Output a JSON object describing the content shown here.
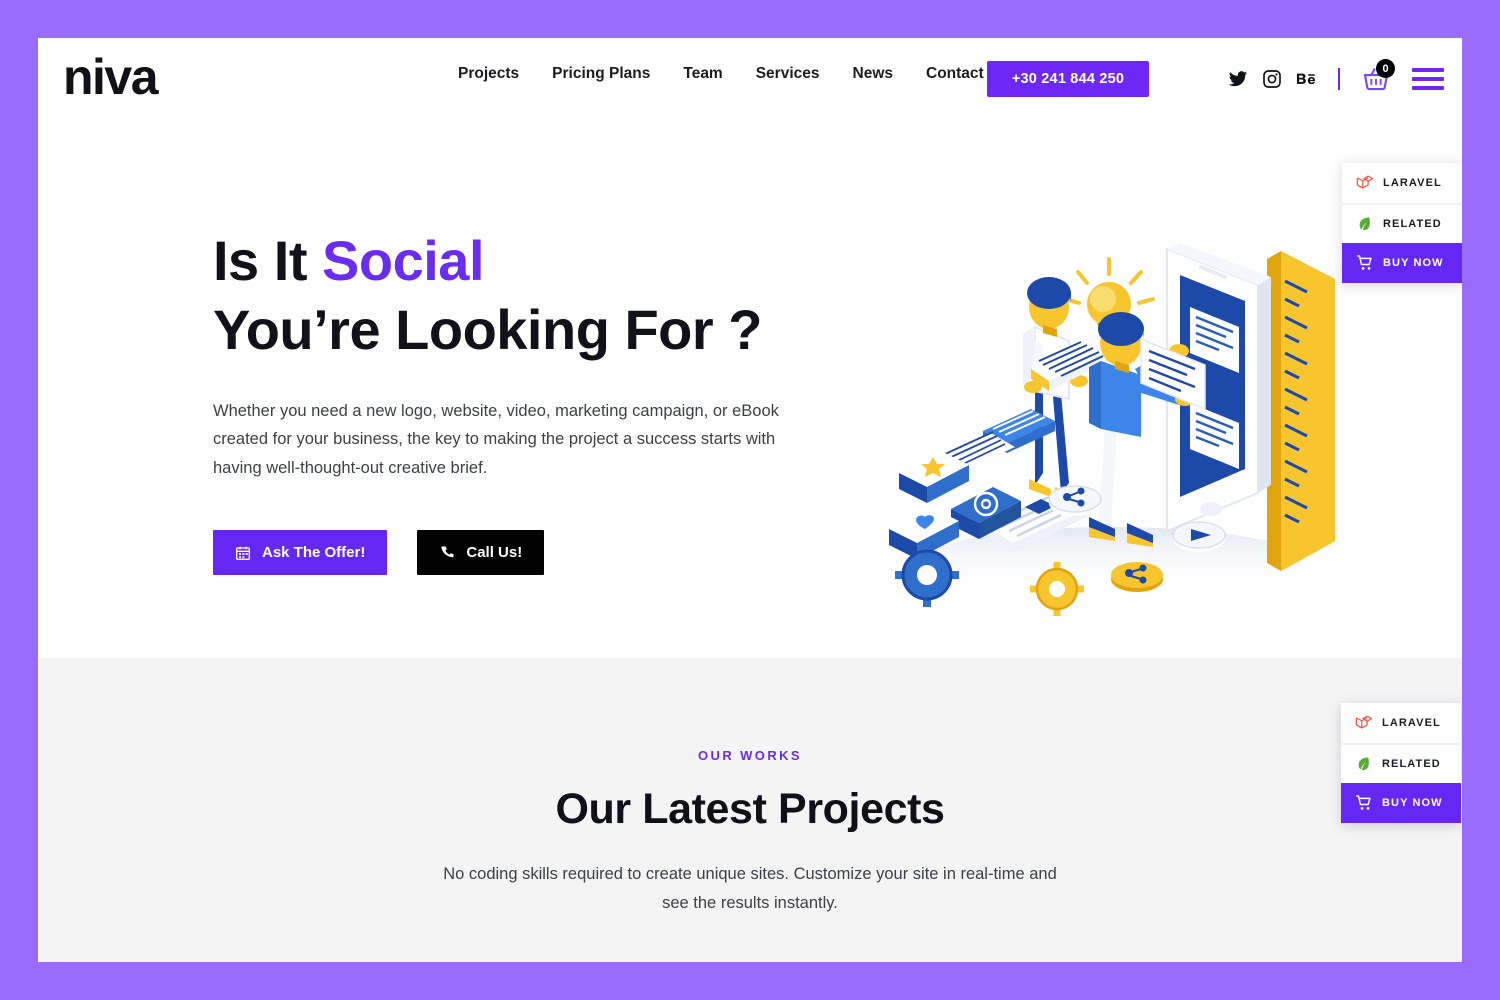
{
  "header": {
    "logo": "niva",
    "nav": [
      {
        "label": "Projects"
      },
      {
        "label": "Pricing Plans"
      },
      {
        "label": "Team"
      },
      {
        "label": "Services"
      },
      {
        "label": "News"
      },
      {
        "label": "Contact"
      }
    ],
    "phone_button": "+30 241 844 250",
    "social": [
      {
        "name": "twitter-icon"
      },
      {
        "name": "instagram-icon"
      },
      {
        "name": "behance-icon"
      }
    ],
    "cart": {
      "icon": "shopping-basket-icon",
      "count": "0"
    },
    "menu": {
      "icon": "hamburger-menu-icon"
    }
  },
  "hero": {
    "title_line1_pre": "Is It ",
    "title_line1_highlight": "Social",
    "title_line2": "You’re Looking For ?",
    "paragraph": "Whether you need a new logo, website, video, marketing campaign, or eBook created for your business, the key to making the project a success starts with having well-thought-out creative brief.",
    "primary_button": {
      "label": "Ask The Offer!",
      "icon": "calendar-icon"
    },
    "secondary_button": {
      "label": "Call Us!",
      "icon": "phone-icon"
    },
    "illustration": "isometric-team-mobile-app-illustration"
  },
  "works": {
    "eyebrow": "OUR WORKS",
    "title": "Our Latest Projects",
    "subtitle": "No coding skills required to create unique sites. Customize your site in real-time and see the results instantly."
  },
  "side_widget": {
    "laravel": {
      "label": "LARAVEL",
      "icon": "laravel-logo-icon"
    },
    "related": {
      "label": "RELATED",
      "icon": "leaf-icon"
    },
    "buy_now": {
      "label": "BUY NOW",
      "icon": "shopping-cart-icon"
    }
  },
  "colors": {
    "page_background": "#9a6cfb",
    "accent_purple": "#6528f2",
    "heading_purple": "#6a2df0",
    "dark": "#000000",
    "section_gray": "#f4f4f5",
    "text_dark": "#101119",
    "text_body": "#3e4048",
    "laravel_red": "#f05340",
    "leaf_green": "#5aab36",
    "illustration_blue": "#1d4aa8",
    "illustration_light_blue": "#3d85e8",
    "illustration_yellow": "#f7c52d"
  }
}
